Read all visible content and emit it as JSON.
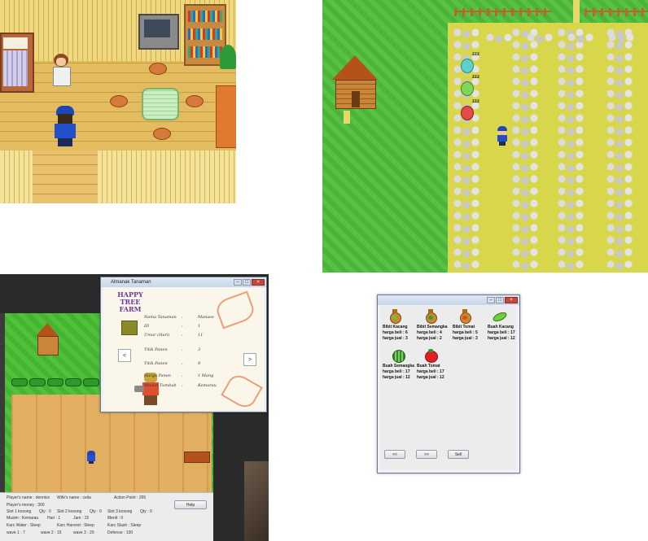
{
  "almanak_window": {
    "title": "Almanak Tanaman",
    "logo_text": "HAPPY TREE FARM",
    "fields": [
      {
        "label": "Nama Tanaman",
        "value": "Manase"
      },
      {
        "label": "ID",
        "value": "1"
      },
      {
        "label": "Umur (Hari)",
        "value": "11"
      },
      {
        "label": "Titik Panen",
        "value": "3"
      },
      {
        "label": "Titik Panen",
        "value": "9"
      },
      {
        "label": "Harga Panen",
        "value": "1 Mang"
      },
      {
        "label": "Musim Tumbuh",
        "value": "Kemarau"
      }
    ],
    "prev_label": "<",
    "next_label": ">"
  },
  "status_panel": {
    "player_name": "Player's name : dennice",
    "wife_name": "Wife's name : celia",
    "action_point": "Action Point : 265",
    "help_label": "Help",
    "money": "Player's money : 300",
    "slot1": "Slot 1 kosong",
    "qty1": "Qty : 0",
    "slot2": "Slot 2 kosong",
    "qty2": "Qty : 0",
    "slot3": "Slot 3 kosong",
    "qty3": "Qty : 0",
    "musim": "Musim : Kemarau",
    "hari": "Hari : 1",
    "jam": "Jam : 15",
    "menit": "Menit : 0",
    "karc_water": "Karc Water : Sleep",
    "karc_harvest": "Karc Harvest : Sleep",
    "karc_slash": "Karc Slash : Sleep",
    "wave1": "wave 1 : 7",
    "wave2": "wave 2 : 15",
    "wave3": "wave 3 : 20",
    "defense": "Defense : 100"
  },
  "shop": {
    "items": [
      {
        "name": "Bibit Kacang",
        "beli": "harga beli : 6",
        "jual": "harga jual : 3",
        "icon": "seed-bag-icon"
      },
      {
        "name": "Bibit Semangka",
        "beli": "harga beli : 4",
        "jual": "harga jual : 2",
        "icon": "seed-bag-icon"
      },
      {
        "name": "Bibit Tomat",
        "beli": "harga beli : 5",
        "jual": "harga jual : 3",
        "icon": "seed-bag-icon"
      },
      {
        "name": "Buah Kacang",
        "beli": "harga beli : 17",
        "jual": "harga jual : 12",
        "icon": "bean-icon"
      },
      {
        "name": "Buah Semangka",
        "beli": "harga beli : 17",
        "jual": "harga jual : 12",
        "icon": "watermelon-icon"
      },
      {
        "name": "Buah Tomat",
        "beli": "harga beli : 17",
        "jual": "harga jual : 12",
        "icon": "tomato-icon"
      }
    ],
    "prev_label": "<<",
    "next_label": ">>",
    "sell_label": "Sell"
  },
  "overworld": {
    "sleep_text": "zzz"
  },
  "colors": {
    "grass": "#58c244",
    "field": "#d8d64a",
    "soil": "#e0ac60",
    "window_frame": "#eef2f7",
    "close_button": "#c9463d"
  }
}
